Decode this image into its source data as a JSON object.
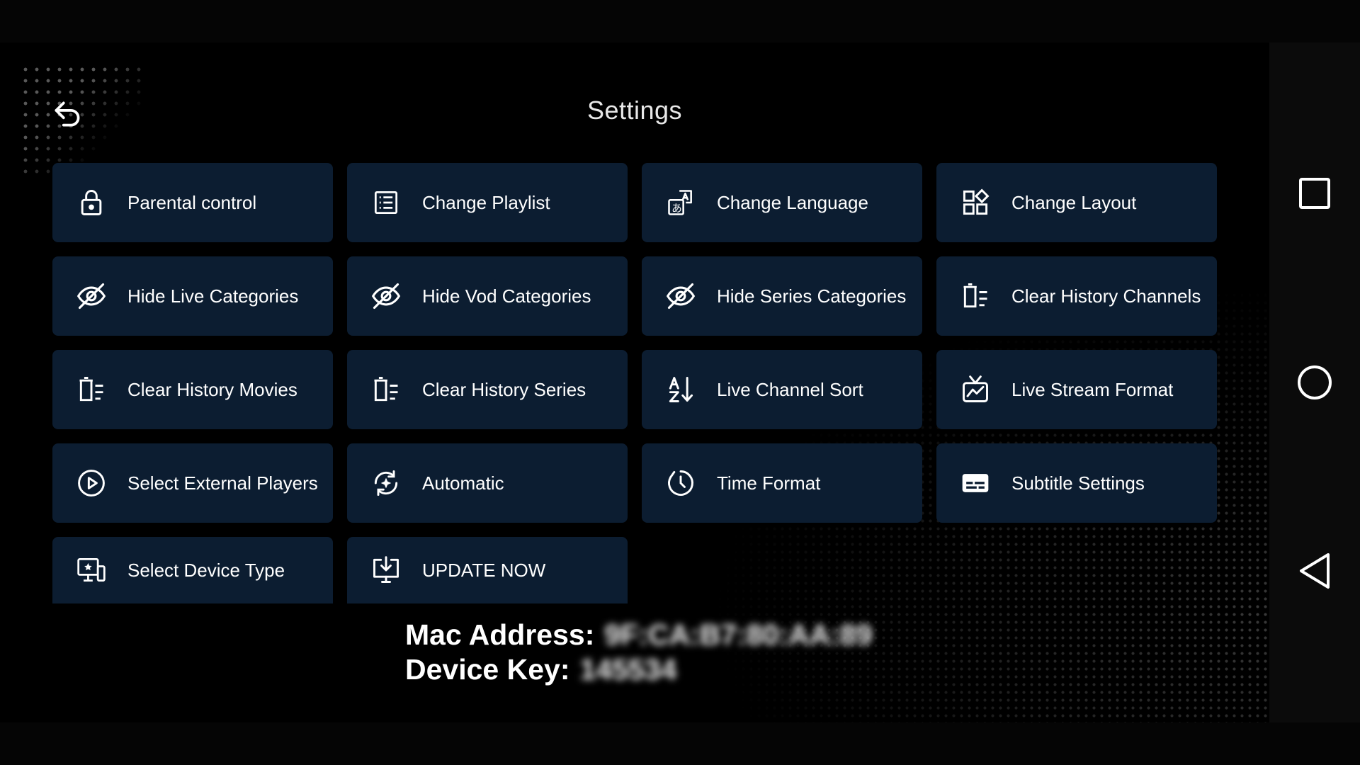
{
  "header": {
    "title": "Settings"
  },
  "tiles": [
    {
      "label": "Parental control",
      "icon": "lock-icon"
    },
    {
      "label": "Change Playlist",
      "icon": "playlist-icon"
    },
    {
      "label": "Change Language",
      "icon": "translate-icon"
    },
    {
      "label": "Change Layout",
      "icon": "layout-icon"
    },
    {
      "label": "Hide Live Categories",
      "icon": "eye-off-icon"
    },
    {
      "label": "Hide Vod Categories",
      "icon": "eye-off-icon"
    },
    {
      "label": "Hide Series Categories",
      "icon": "eye-off-icon"
    },
    {
      "label": "Clear History Channels",
      "icon": "clear-history-icon"
    },
    {
      "label": "Clear History Movies",
      "icon": "clear-history-icon"
    },
    {
      "label": "Clear History Series",
      "icon": "clear-history-icon"
    },
    {
      "label": "Live Channel Sort",
      "icon": "sort-az-icon"
    },
    {
      "label": "Live Stream Format",
      "icon": "tv-stream-icon"
    },
    {
      "label": "Select External Players",
      "icon": "play-circle-icon"
    },
    {
      "label": "Automatic",
      "icon": "auto-refresh-icon"
    },
    {
      "label": "Time Format",
      "icon": "clock-icon"
    },
    {
      "label": "Subtitle Settings",
      "icon": "subtitles-icon"
    },
    {
      "label": "Select Device Type",
      "icon": "device-icon"
    },
    {
      "label": "UPDATE NOW",
      "icon": "download-icon"
    }
  ],
  "info": {
    "mac_label": "Mac Address:",
    "mac_value": "9F:CA:B7:80:AA:89",
    "key_label": "Device Key:",
    "key_value": "145534"
  },
  "colors": {
    "tile_bg": "#0c1d31",
    "background": "#000000",
    "text": "#ffffff"
  }
}
